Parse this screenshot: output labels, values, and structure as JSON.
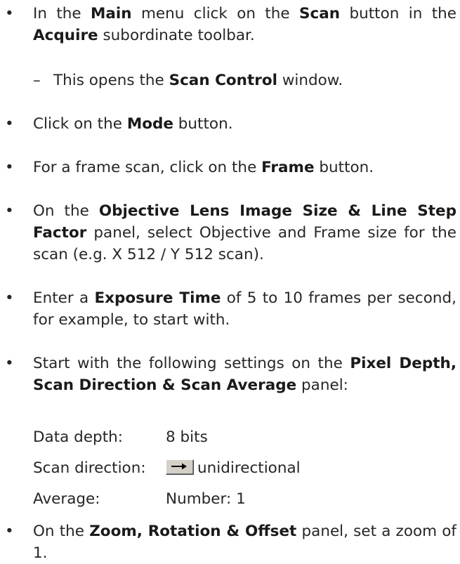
{
  "items": [
    {
      "bullet": "•",
      "parts": [
        {
          "t": "In the "
        },
        {
          "t": "Main",
          "b": true
        },
        {
          "t": " menu click on the "
        },
        {
          "t": "Scan",
          "b": true
        },
        {
          "t": " button in the "
        },
        {
          "t": "Acquire",
          "b": true
        },
        {
          "t": " subordinate toolbar."
        }
      ]
    },
    {
      "dash": "–",
      "parts": [
        {
          "t": "This opens the "
        },
        {
          "t": "Scan Control",
          "b": true
        },
        {
          "t": " window."
        }
      ]
    },
    {
      "bullet": "•",
      "parts": [
        {
          "t": "Click on the "
        },
        {
          "t": "Mode",
          "b": true
        },
        {
          "t": " button."
        }
      ]
    },
    {
      "bullet": "•",
      "parts": [
        {
          "t": "For a frame scan, click on the "
        },
        {
          "t": "Frame",
          "b": true
        },
        {
          "t": " button."
        }
      ]
    },
    {
      "bullet": "•",
      "parts": [
        {
          "t": "On the "
        },
        {
          "t": "Objective Lens Image Size & Line Step Factor",
          "b": true
        },
        {
          "t": " panel, select Objective and Frame size for the scan (e.g. X 512 / Y 512 scan)."
        }
      ]
    },
    {
      "bullet": "•",
      "parts": [
        {
          "t": "Enter a "
        },
        {
          "t": "Exposure Time",
          "b": true
        },
        {
          "t": " of 5 to 10 frames per second, for example, to start with."
        }
      ]
    },
    {
      "bullet": "•",
      "parts": [
        {
          "t": "Start with the following settings on the "
        },
        {
          "t": "Pixel Depth, Scan Direction & Scan Average",
          "b": true
        },
        {
          "t": " panel:"
        }
      ]
    },
    {
      "bullet": "•",
      "parts": [
        {
          "t": "On the "
        },
        {
          "t": "Zoom, Rotation & Offset",
          "b": true
        },
        {
          "t": " panel, set a zoom of 1."
        }
      ]
    }
  ],
  "settings": {
    "data_depth_label": "Data depth:",
    "data_depth_value": "8 bits",
    "scan_direction_label": "Scan direction:",
    "scan_direction_value": "unidirectional",
    "scan_direction_icon": "right-arrow-icon",
    "average_label": "Average:",
    "average_value": "Number: 1"
  }
}
